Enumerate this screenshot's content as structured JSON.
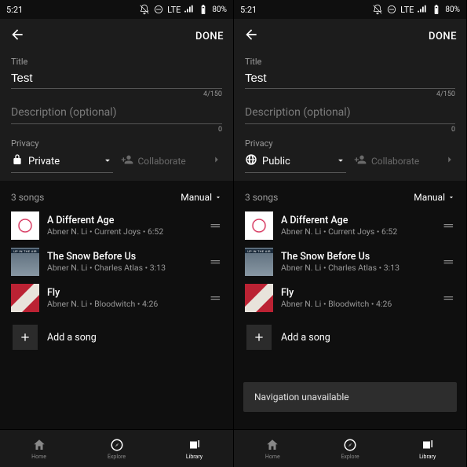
{
  "status": {
    "time": "5:21",
    "network": "LTE",
    "battery": "80%"
  },
  "topbar": {
    "done": "DONE"
  },
  "fields": {
    "title_label": "Title",
    "title_value": "Test",
    "title_counter": "4/150",
    "desc_placeholder": "Description (optional)",
    "desc_counter": "0",
    "privacy_label": "Privacy",
    "collaborate": "Collaborate"
  },
  "privacy_left": "Private",
  "privacy_right": "Public",
  "list": {
    "count": "3 songs",
    "sort": "Manual",
    "add": "Add a song"
  },
  "songs": [
    {
      "title": "A Different Age",
      "sub": "Abner N. Li • Current Joys • 6:52"
    },
    {
      "title": "The Snow Before Us",
      "sub": "Abner N. Li • Charles Atlas • 3:13"
    },
    {
      "title": "Fly",
      "sub": "Abner N. Li • Bloodwitch • 4:26"
    }
  ],
  "toast": "Navigation unavailable",
  "nav": {
    "home": "Home",
    "explore": "Explore",
    "library": "Library"
  }
}
